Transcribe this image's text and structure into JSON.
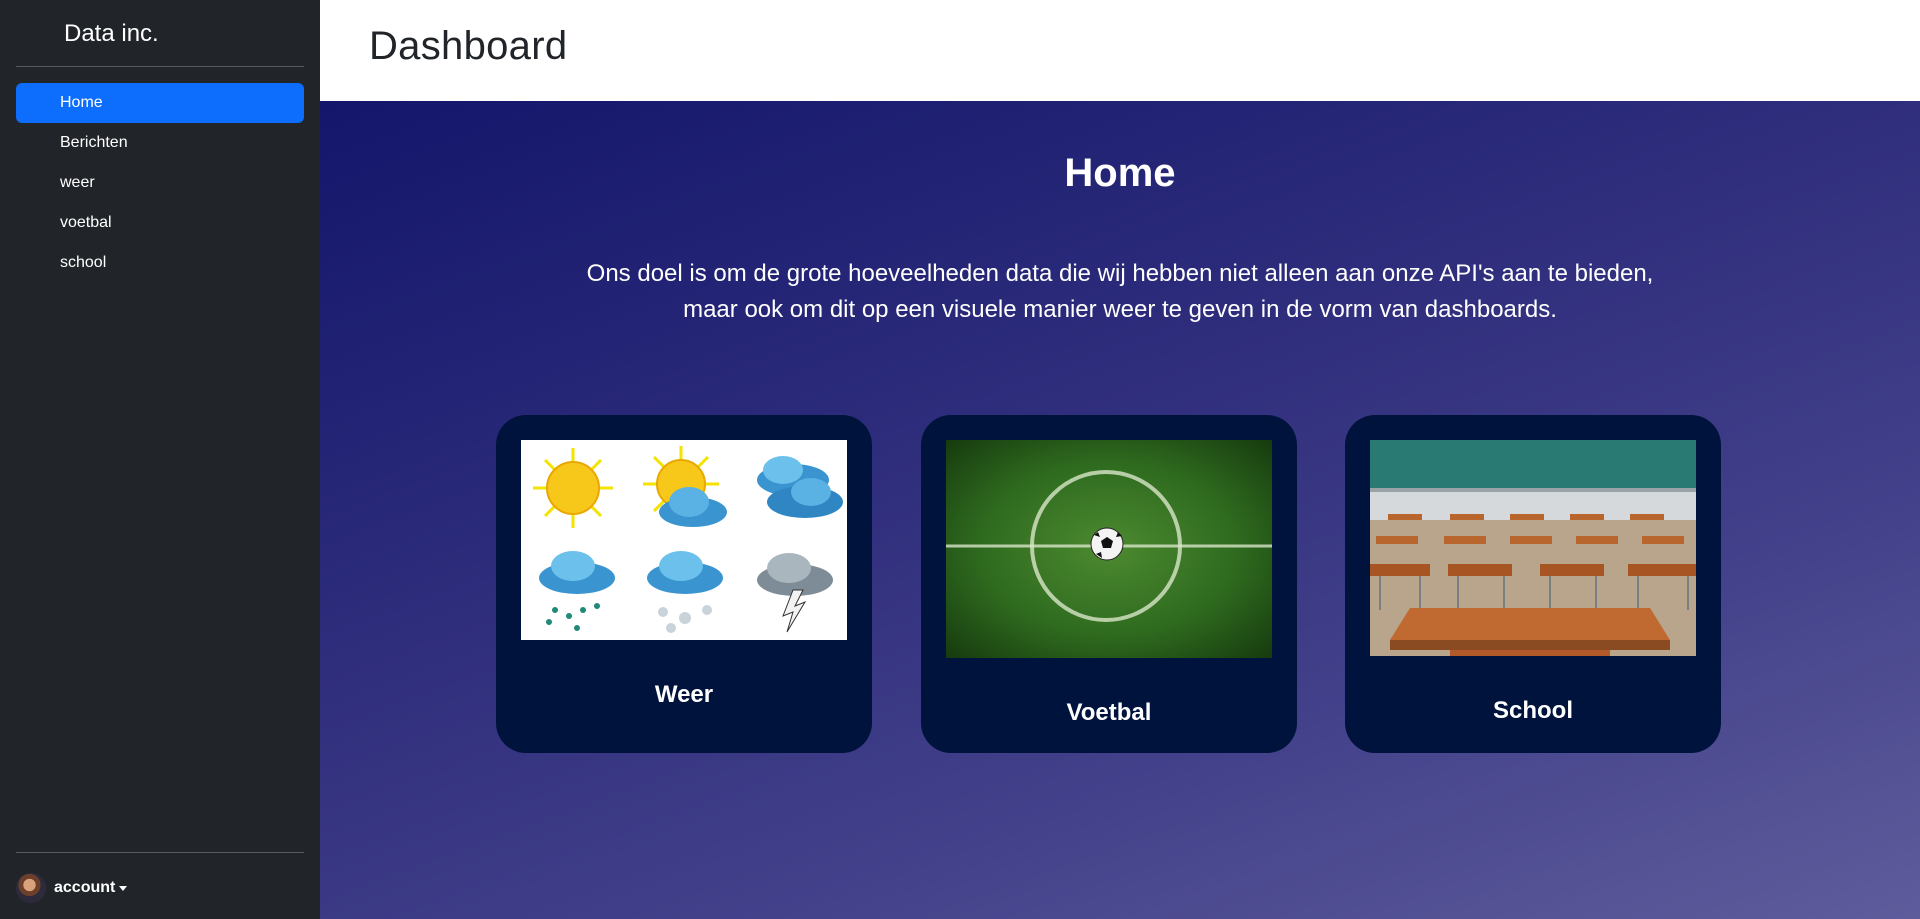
{
  "sidebar": {
    "brand": "Data inc.",
    "items": [
      {
        "label": "Home",
        "active": true
      },
      {
        "label": "Berichten",
        "active": false
      },
      {
        "label": "weer",
        "active": false
      },
      {
        "label": "voetbal",
        "active": false
      },
      {
        "label": "school",
        "active": false
      }
    ],
    "account_label": "account"
  },
  "header": {
    "title": "Dashboard"
  },
  "main": {
    "title": "Home",
    "intro_line1": "Ons doel is om de grote hoeveelheden data die wij hebben niet alleen aan onze API's aan te bieden,",
    "intro_line2": "maar ook om dit op een visuele manier weer te geven in de vorm van dashboards.",
    "cards": [
      {
        "label": "Weer",
        "image": "weather-icons-image"
      },
      {
        "label": "Voetbal",
        "image": "football-field-image"
      },
      {
        "label": "School",
        "image": "classroom-image"
      }
    ]
  },
  "colors": {
    "sidebar_bg": "#212529",
    "active_item": "#0d6efd",
    "card_bg": "#00133d",
    "gradient_start": "#13166b",
    "gradient_end": "#5f5c9c"
  }
}
